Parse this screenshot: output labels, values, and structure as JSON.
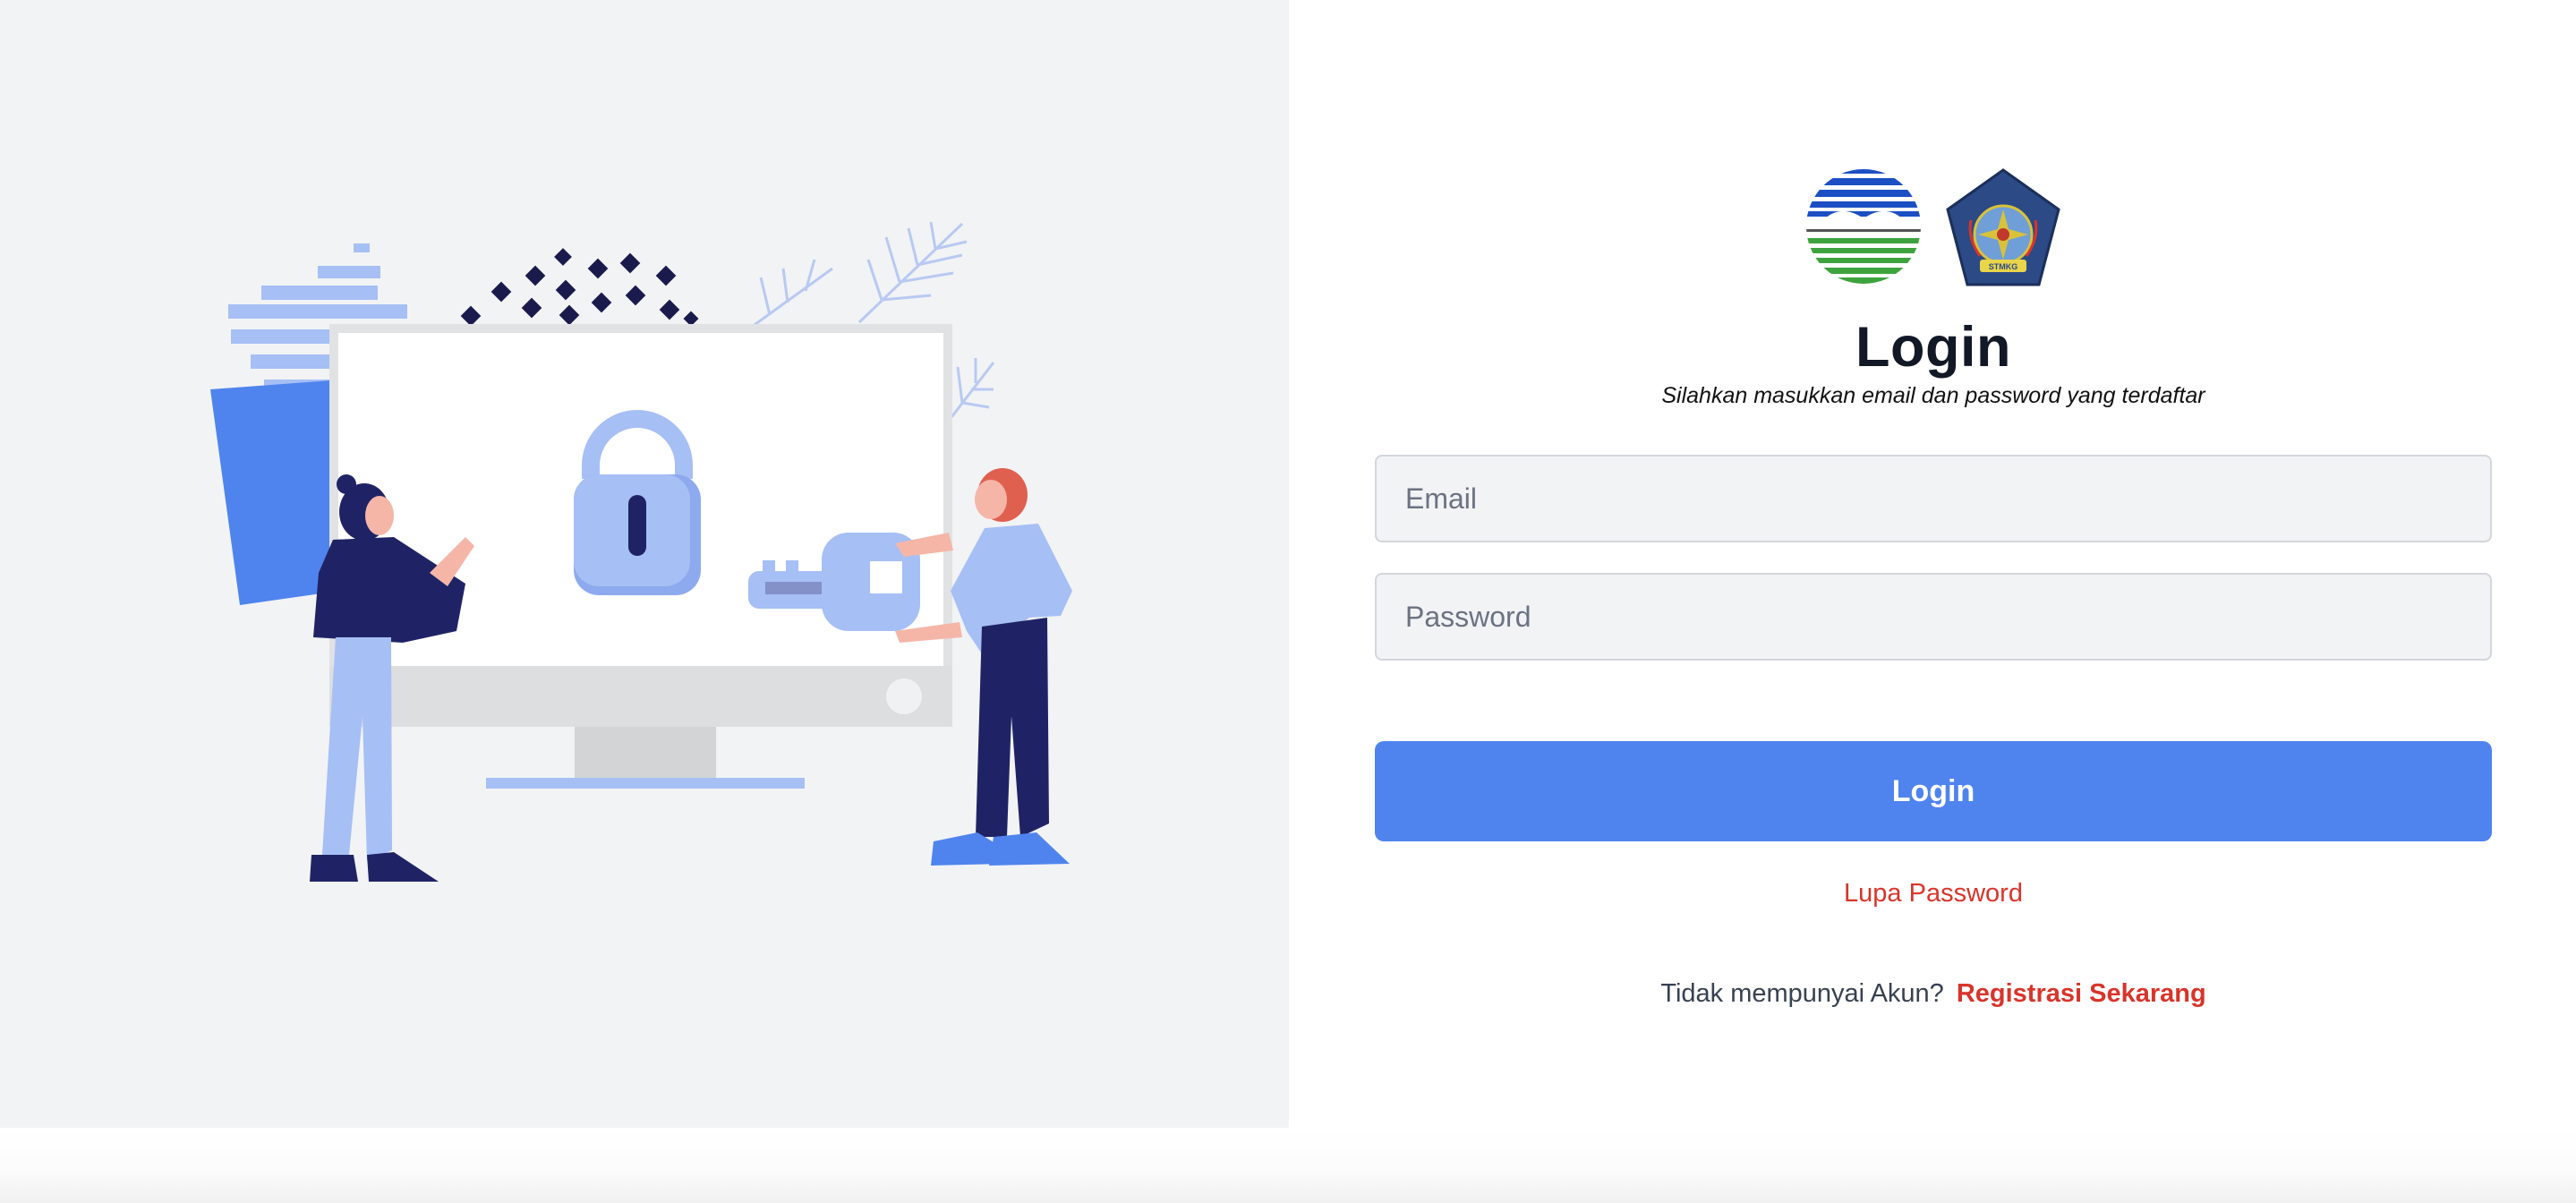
{
  "login": {
    "title": "Login",
    "subtitle": "Silahkan masukkan email dan password yang terdaftar",
    "email_placeholder": "Email",
    "password_placeholder": "Password",
    "submit_label": "Login",
    "forgot_label": "Lupa Password",
    "register_prompt": "Tidak mempunyai Akun?",
    "register_link": "Registrasi Sekarang",
    "logo_right_ribbon": "STMKG"
  },
  "colors": {
    "primary": "#4f84ee",
    "link_red": "#d9342b",
    "left_panel_bg": "#f2f3f5",
    "illustration_navy": "#1f2366",
    "illustration_lightblue": "#a6bff5"
  },
  "icons": [
    "lock-icon",
    "key-icon",
    "bmkg-logo",
    "stmkg-logo"
  ]
}
